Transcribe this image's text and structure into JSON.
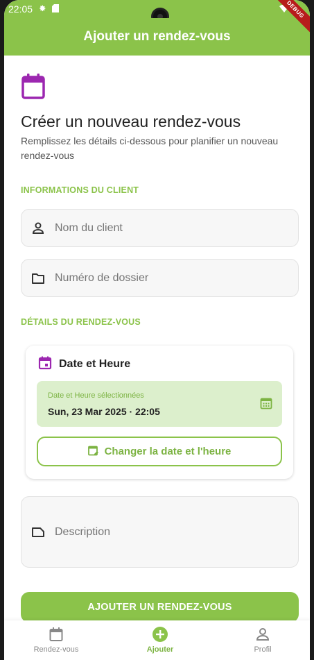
{
  "status_bar": {
    "time": "22:05",
    "debug": "DEBUG"
  },
  "app_bar": {
    "title": "Ajouter un rendez-vous"
  },
  "header": {
    "title": "Créer un nouveau rendez-vous",
    "subtitle": "Remplissez les détails ci-dessous pour planifier un nouveau rendez-vous"
  },
  "client_section": {
    "label": "INFORMATIONS DU CLIENT",
    "name_field": {
      "placeholder": "Nom du client",
      "value": ""
    },
    "file_field": {
      "placeholder": "Numéro de dossier",
      "value": ""
    }
  },
  "details_section": {
    "label": "DÉTAILS DU RENDEZ-VOUS",
    "datetime_card": {
      "title": "Date et Heure",
      "selected_label": "Date et Heure sélectionnées",
      "selected_value": "Sun, 23 Mar 2025 · 22:05",
      "change_button": "Changer la date et l'heure"
    },
    "description_field": {
      "placeholder": "Description",
      "value": ""
    }
  },
  "submit_button": "AJOUTER UN RENDEZ-VOUS",
  "bottom_nav": {
    "items": [
      {
        "label": "Rendez-vous",
        "icon": "calendar-icon"
      },
      {
        "label": "Ajouter",
        "icon": "add-circle-icon"
      },
      {
        "label": "Profil",
        "icon": "person-icon"
      }
    ],
    "active_index": 1
  },
  "colors": {
    "primary": "#8bc34a",
    "accent_purple": "#9c27b0",
    "selected_bg": "#dcefcc"
  }
}
